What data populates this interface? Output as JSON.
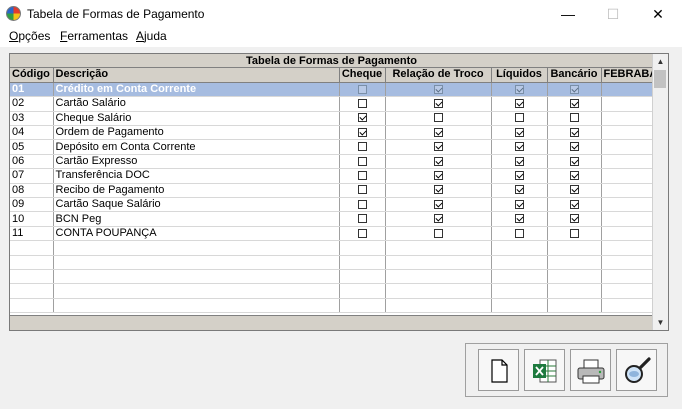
{
  "window": {
    "title": "Tabela de Formas de Pagamento",
    "minimize": "—",
    "maximize": "☐",
    "close": "✕"
  },
  "menu": {
    "items": [
      {
        "accel": "O",
        "rest": "pções"
      },
      {
        "accel": "F",
        "rest": "erramentas"
      },
      {
        "accel": "A",
        "rest": "juda"
      }
    ]
  },
  "grid": {
    "title": "Tabela de Formas de Pagamento",
    "columns": [
      "Código",
      "Descrição",
      "Cheque",
      "Relação de Troco",
      "Líquidos",
      "Bancário",
      "FEBRABAN"
    ],
    "rows": [
      {
        "codigo": "01",
        "descricao": "Crédito em Conta Corrente",
        "cheque": false,
        "troco": true,
        "liquidos": true,
        "bancario": true,
        "selected": true
      },
      {
        "codigo": "02",
        "descricao": "Cartão Salário",
        "cheque": false,
        "troco": true,
        "liquidos": true,
        "bancario": true
      },
      {
        "codigo": "03",
        "descricao": "Cheque Salário",
        "cheque": true,
        "troco": false,
        "liquidos": false,
        "bancario": false
      },
      {
        "codigo": "04",
        "descricao": "Ordem de Pagamento",
        "cheque": true,
        "troco": true,
        "liquidos": true,
        "bancario": true
      },
      {
        "codigo": "05",
        "descricao": "Depósito em Conta Corrente",
        "cheque": false,
        "troco": true,
        "liquidos": true,
        "bancario": true
      },
      {
        "codigo": "06",
        "descricao": "Cartão Expresso",
        "cheque": false,
        "troco": true,
        "liquidos": true,
        "bancario": true
      },
      {
        "codigo": "07",
        "descricao": "Transferência DOC",
        "cheque": false,
        "troco": true,
        "liquidos": true,
        "bancario": true
      },
      {
        "codigo": "08",
        "descricao": "Recibo de Pagamento",
        "cheque": false,
        "troco": true,
        "liquidos": true,
        "bancario": true
      },
      {
        "codigo": "09",
        "descricao": "Cartão Saque Salário",
        "cheque": false,
        "troco": true,
        "liquidos": true,
        "bancario": true
      },
      {
        "codigo": "10",
        "descricao": "BCN Peg",
        "cheque": false,
        "troco": true,
        "liquidos": true,
        "bancario": true
      },
      {
        "codigo": "11",
        "descricao": "CONTA POUPANÇA",
        "cheque": false,
        "troco": false,
        "liquidos": false,
        "bancario": false
      }
    ],
    "empty_rows": 5
  },
  "toolbar": {
    "buttons": [
      {
        "name": "new-document-button",
        "icon": "blank-page-icon"
      },
      {
        "name": "export-excel-button",
        "icon": "excel-icon"
      },
      {
        "name": "print-button",
        "icon": "printer-icon"
      },
      {
        "name": "search-button",
        "icon": "magnifier-icon"
      }
    ]
  },
  "colors": {
    "selected_row": "#a6bce0",
    "header_bg": "#d4d0c8"
  }
}
